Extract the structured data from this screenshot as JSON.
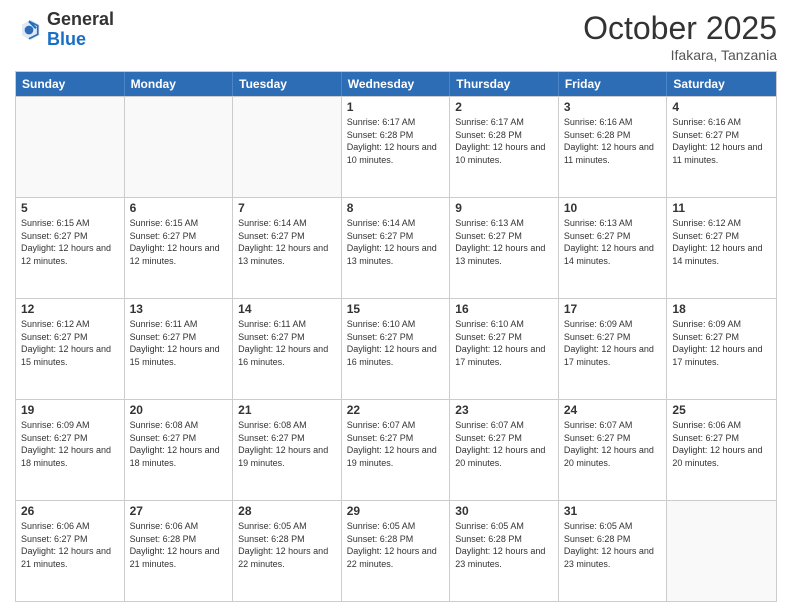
{
  "header": {
    "logo_general": "General",
    "logo_blue": "Blue",
    "month": "October 2025",
    "location": "Ifakara, Tanzania"
  },
  "weekdays": [
    "Sunday",
    "Monday",
    "Tuesday",
    "Wednesday",
    "Thursday",
    "Friday",
    "Saturday"
  ],
  "rows": [
    [
      {
        "day": "",
        "empty": true
      },
      {
        "day": "",
        "empty": true
      },
      {
        "day": "",
        "empty": true
      },
      {
        "day": "1",
        "sunrise": "6:17 AM",
        "sunset": "6:28 PM",
        "daylight": "12 hours and 10 minutes."
      },
      {
        "day": "2",
        "sunrise": "6:17 AM",
        "sunset": "6:28 PM",
        "daylight": "12 hours and 10 minutes."
      },
      {
        "day": "3",
        "sunrise": "6:16 AM",
        "sunset": "6:28 PM",
        "daylight": "12 hours and 11 minutes."
      },
      {
        "day": "4",
        "sunrise": "6:16 AM",
        "sunset": "6:27 PM",
        "daylight": "12 hours and 11 minutes."
      }
    ],
    [
      {
        "day": "5",
        "sunrise": "6:15 AM",
        "sunset": "6:27 PM",
        "daylight": "12 hours and 12 minutes."
      },
      {
        "day": "6",
        "sunrise": "6:15 AM",
        "sunset": "6:27 PM",
        "daylight": "12 hours and 12 minutes."
      },
      {
        "day": "7",
        "sunrise": "6:14 AM",
        "sunset": "6:27 PM",
        "daylight": "12 hours and 13 minutes."
      },
      {
        "day": "8",
        "sunrise": "6:14 AM",
        "sunset": "6:27 PM",
        "daylight": "12 hours and 13 minutes."
      },
      {
        "day": "9",
        "sunrise": "6:13 AM",
        "sunset": "6:27 PM",
        "daylight": "12 hours and 13 minutes."
      },
      {
        "day": "10",
        "sunrise": "6:13 AM",
        "sunset": "6:27 PM",
        "daylight": "12 hours and 14 minutes."
      },
      {
        "day": "11",
        "sunrise": "6:12 AM",
        "sunset": "6:27 PM",
        "daylight": "12 hours and 14 minutes."
      }
    ],
    [
      {
        "day": "12",
        "sunrise": "6:12 AM",
        "sunset": "6:27 PM",
        "daylight": "12 hours and 15 minutes."
      },
      {
        "day": "13",
        "sunrise": "6:11 AM",
        "sunset": "6:27 PM",
        "daylight": "12 hours and 15 minutes."
      },
      {
        "day": "14",
        "sunrise": "6:11 AM",
        "sunset": "6:27 PM",
        "daylight": "12 hours and 16 minutes."
      },
      {
        "day": "15",
        "sunrise": "6:10 AM",
        "sunset": "6:27 PM",
        "daylight": "12 hours and 16 minutes."
      },
      {
        "day": "16",
        "sunrise": "6:10 AM",
        "sunset": "6:27 PM",
        "daylight": "12 hours and 17 minutes."
      },
      {
        "day": "17",
        "sunrise": "6:09 AM",
        "sunset": "6:27 PM",
        "daylight": "12 hours and 17 minutes."
      },
      {
        "day": "18",
        "sunrise": "6:09 AM",
        "sunset": "6:27 PM",
        "daylight": "12 hours and 17 minutes."
      }
    ],
    [
      {
        "day": "19",
        "sunrise": "6:09 AM",
        "sunset": "6:27 PM",
        "daylight": "12 hours and 18 minutes."
      },
      {
        "day": "20",
        "sunrise": "6:08 AM",
        "sunset": "6:27 PM",
        "daylight": "12 hours and 18 minutes."
      },
      {
        "day": "21",
        "sunrise": "6:08 AM",
        "sunset": "6:27 PM",
        "daylight": "12 hours and 19 minutes."
      },
      {
        "day": "22",
        "sunrise": "6:07 AM",
        "sunset": "6:27 PM",
        "daylight": "12 hours and 19 minutes."
      },
      {
        "day": "23",
        "sunrise": "6:07 AM",
        "sunset": "6:27 PM",
        "daylight": "12 hours and 20 minutes."
      },
      {
        "day": "24",
        "sunrise": "6:07 AM",
        "sunset": "6:27 PM",
        "daylight": "12 hours and 20 minutes."
      },
      {
        "day": "25",
        "sunrise": "6:06 AM",
        "sunset": "6:27 PM",
        "daylight": "12 hours and 20 minutes."
      }
    ],
    [
      {
        "day": "26",
        "sunrise": "6:06 AM",
        "sunset": "6:27 PM",
        "daylight": "12 hours and 21 minutes."
      },
      {
        "day": "27",
        "sunrise": "6:06 AM",
        "sunset": "6:28 PM",
        "daylight": "12 hours and 21 minutes."
      },
      {
        "day": "28",
        "sunrise": "6:05 AM",
        "sunset": "6:28 PM",
        "daylight": "12 hours and 22 minutes."
      },
      {
        "day": "29",
        "sunrise": "6:05 AM",
        "sunset": "6:28 PM",
        "daylight": "12 hours and 22 minutes."
      },
      {
        "day": "30",
        "sunrise": "6:05 AM",
        "sunset": "6:28 PM",
        "daylight": "12 hours and 23 minutes."
      },
      {
        "day": "31",
        "sunrise": "6:05 AM",
        "sunset": "6:28 PM",
        "daylight": "12 hours and 23 minutes."
      },
      {
        "day": "",
        "empty": true
      }
    ]
  ]
}
